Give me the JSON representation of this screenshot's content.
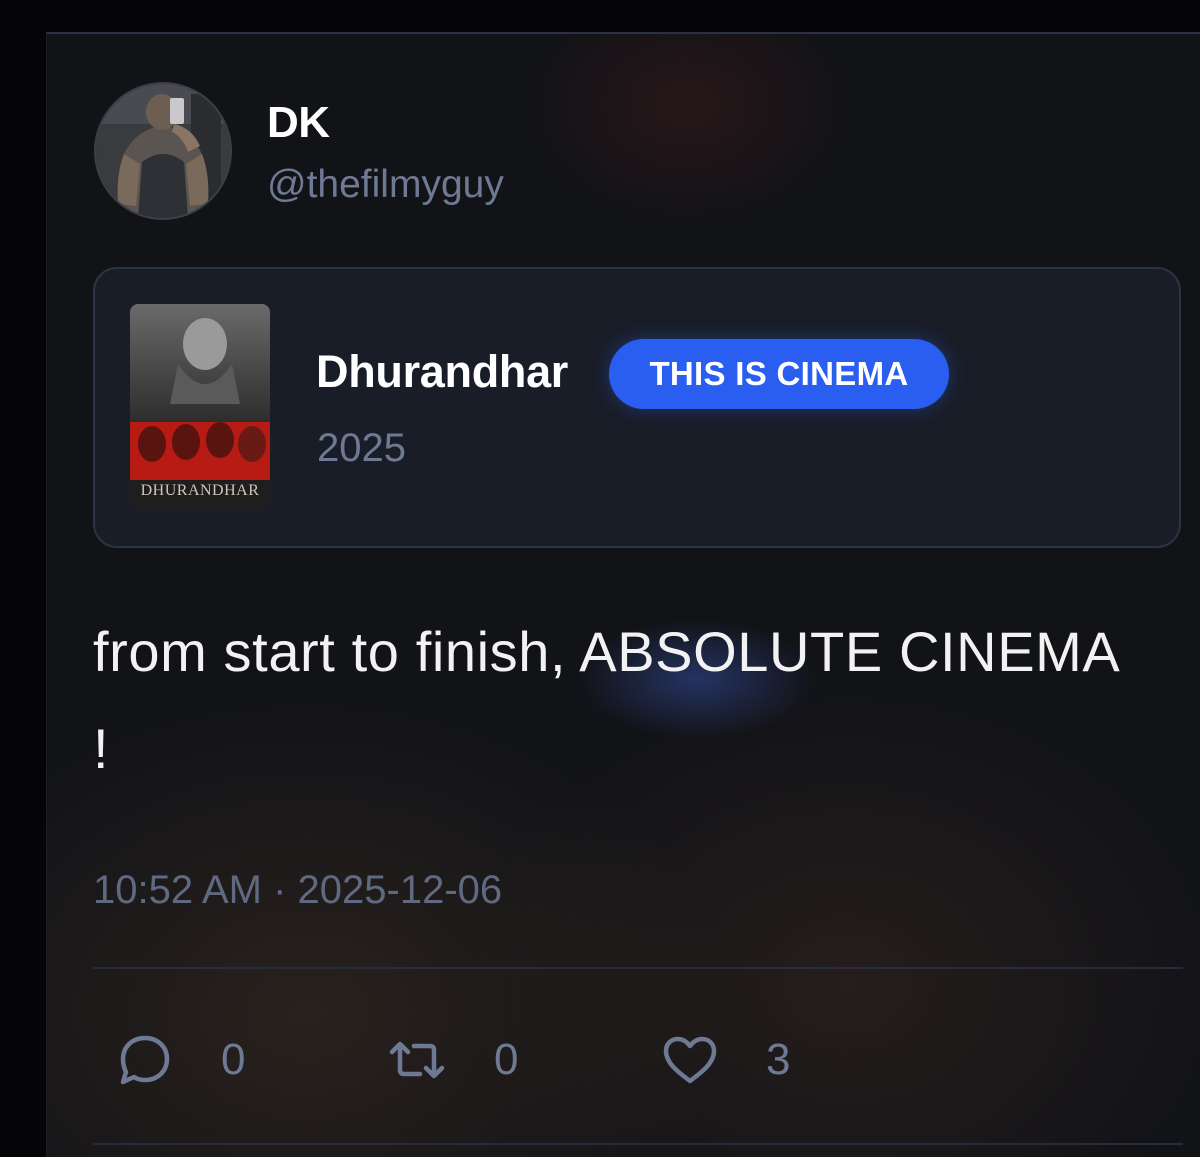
{
  "post": {
    "author": {
      "display_name": "DK",
      "handle": "@thefilmyguy",
      "avatar_icon": "user-avatar-photo"
    },
    "movie": {
      "title": "Dhurandhar",
      "year": "2025",
      "badge": "THIS IS CINEMA",
      "badge_color": "#2a5ef0",
      "poster_text": "DHURANDHAR"
    },
    "text_line1": "from start to finish, ABSOLUTE CINEMA",
    "text_line2": "!",
    "timestamp": "10:52 AM · 2025-12-06",
    "actions": {
      "reply_icon": "reply-bubble-icon",
      "reply_count": "0",
      "repost_icon": "repost-icon",
      "repost_count": "0",
      "like_icon": "heart-icon",
      "like_count": "3"
    }
  },
  "colors": {
    "background": "#121317",
    "card_background": "#191d27",
    "muted_text": "#6e7a93",
    "divider": "#262c3a"
  }
}
